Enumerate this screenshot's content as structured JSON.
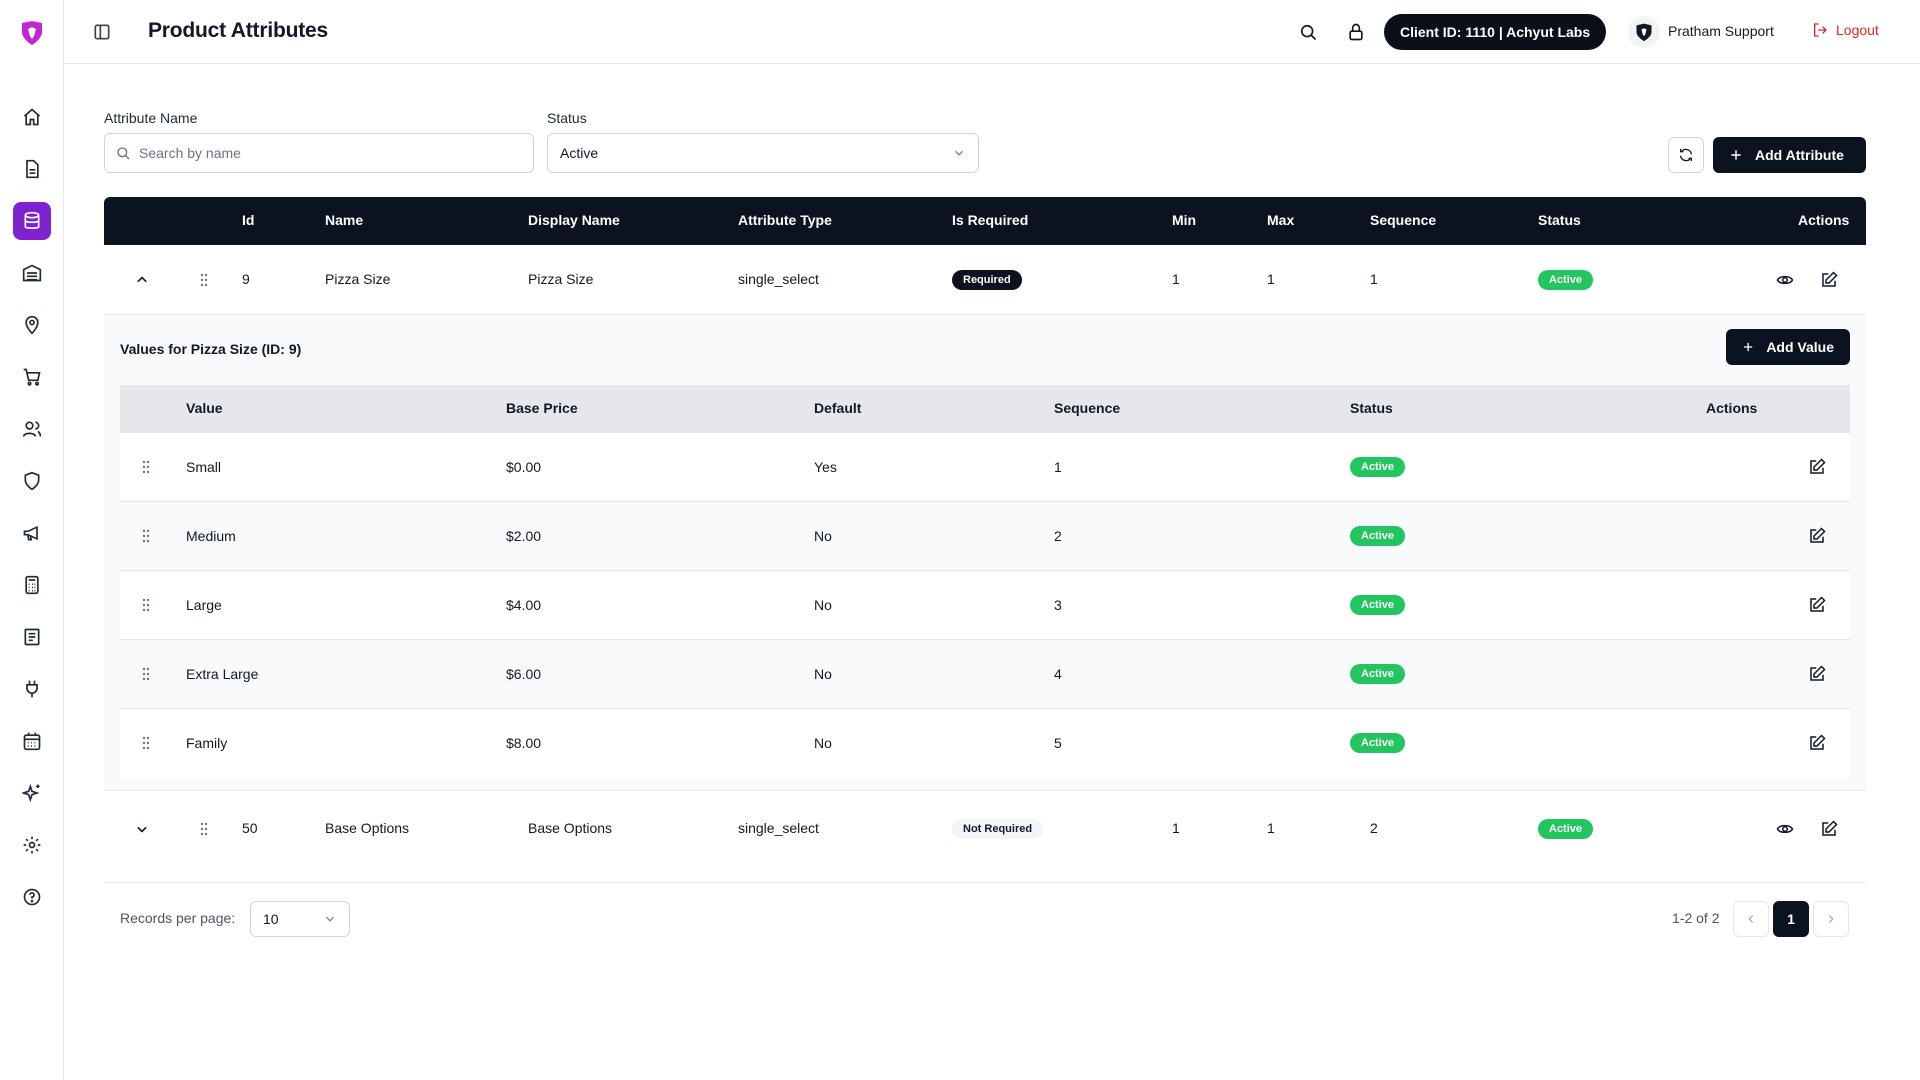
{
  "header": {
    "title": "Product Attributes",
    "client": "Client ID: 1110 | Achyut Labs",
    "user": "Pratham Support",
    "logout": "Logout"
  },
  "sidebar": {
    "items": [
      {
        "icon": "home-icon"
      },
      {
        "icon": "document-icon"
      },
      {
        "icon": "database-icon",
        "active": true
      },
      {
        "icon": "inventory-icon"
      },
      {
        "icon": "location-pin-icon"
      },
      {
        "icon": "cart-icon"
      },
      {
        "icon": "users-icon"
      },
      {
        "icon": "shield-icon"
      },
      {
        "icon": "megaphone-icon"
      },
      {
        "icon": "calculator-icon"
      },
      {
        "icon": "receipt-icon"
      },
      {
        "icon": "plug-icon"
      },
      {
        "icon": "calendar-icon"
      },
      {
        "icon": "sparkles-icon"
      },
      {
        "icon": "settings-icon"
      },
      {
        "icon": "help-icon"
      }
    ]
  },
  "filters": {
    "name_label": "Attribute Name",
    "search_placeholder": "Search by name",
    "status_label": "Status",
    "status_value": "Active",
    "add_attribute": "Add Attribute"
  },
  "table": {
    "columns": [
      "Id",
      "Name",
      "Display Name",
      "Attribute Type",
      "Is Required",
      "Min",
      "Max",
      "Sequence",
      "Status",
      "Actions"
    ],
    "rows": [
      {
        "id": "9",
        "name": "Pizza Size",
        "display_name": "Pizza Size",
        "type": "single_select",
        "required": "Required",
        "min": "1",
        "max": "1",
        "sequence": "1",
        "status": "Active",
        "expanded": true
      },
      {
        "id": "50",
        "name": "Base Options",
        "display_name": "Base Options",
        "type": "single_select",
        "required": "Not Required",
        "min": "1",
        "max": "1",
        "sequence": "2",
        "status": "Active",
        "expanded": false
      }
    ]
  },
  "values_panel": {
    "title": "Values for Pizza Size (ID: 9)",
    "add_value": "Add Value",
    "columns": [
      "Value",
      "Base Price",
      "Default",
      "Sequence",
      "Status",
      "Actions"
    ],
    "rows": [
      {
        "value": "Small",
        "price": "$0.00",
        "default": "Yes",
        "sequence": "1",
        "status": "Active"
      },
      {
        "value": "Medium",
        "price": "$2.00",
        "default": "No",
        "sequence": "2",
        "status": "Active"
      },
      {
        "value": "Large",
        "price": "$4.00",
        "default": "No",
        "sequence": "3",
        "status": "Active"
      },
      {
        "value": "Extra Large",
        "price": "$6.00",
        "default": "No",
        "sequence": "4",
        "status": "Active"
      },
      {
        "value": "Family",
        "price": "$8.00",
        "default": "No",
        "sequence": "5",
        "status": "Active"
      }
    ]
  },
  "pagination": {
    "label": "Records per page:",
    "per_page": "10",
    "info": "1-2 of 2",
    "current_page": "1"
  },
  "colors": {
    "accent": "#7e22ce",
    "dark": "#0b1220",
    "success": "#22c55e",
    "danger": "#dc2626"
  }
}
